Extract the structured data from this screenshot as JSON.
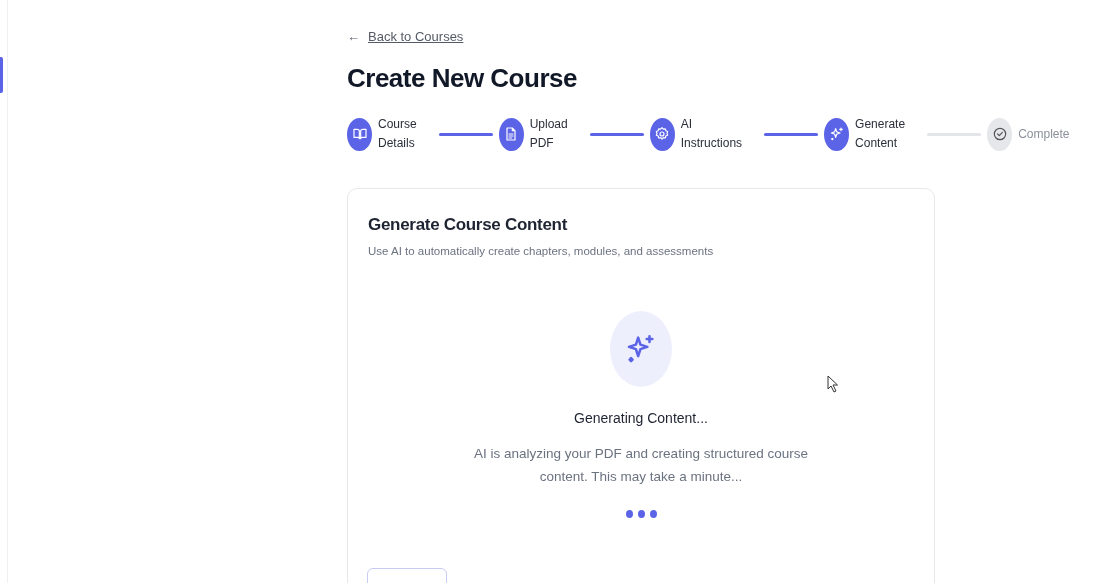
{
  "back_link": {
    "label": "Back to Courses",
    "arrow": "←"
  },
  "title": "Create New Course",
  "steps": [
    {
      "label": "Course Details",
      "completed": true
    },
    {
      "label": "Upload PDF",
      "completed": true
    },
    {
      "label": "AI Instructions",
      "completed": true
    },
    {
      "label": "Generate Content",
      "completed": true
    },
    {
      "label": "Complete",
      "completed": false
    }
  ],
  "card": {
    "title": "Generate Course Content",
    "subtitle": "Use AI to automatically create chapters, modules, and assessments",
    "status_title": "Generating Content...",
    "status_text": "AI is analyzing your PDF and creating structured course content. This may take a minute..."
  }
}
